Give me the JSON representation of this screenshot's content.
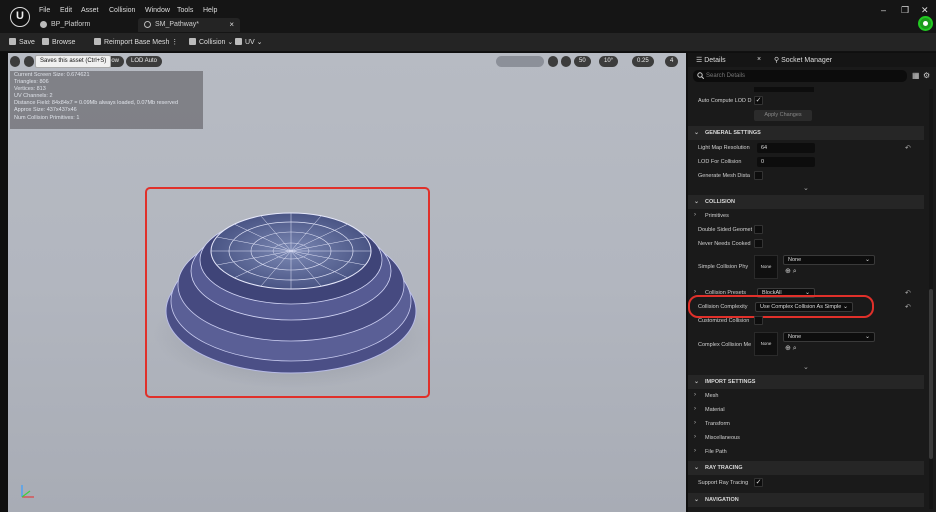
{
  "app": {
    "logo": "U",
    "menu": [
      "File",
      "Edit",
      "Asset",
      "Collision",
      "Window",
      "Tools",
      "Help"
    ],
    "tabs": [
      {
        "label": "BP_Platform",
        "icon": "blueprint-icon"
      },
      {
        "label": "SM_Pathway*",
        "icon": "static-mesh-icon"
      }
    ],
    "tab_close": "×",
    "window_controls": {
      "minimize": "–",
      "maximize": "❐",
      "close": "✕"
    }
  },
  "toolbar": {
    "save_label": "Save",
    "browse_label": "Browse",
    "reimport_label": "Reimport Base Mesh",
    "collision_label": "Collision",
    "uv_label": "UV",
    "tooltip": "Saves this asset (Ctrl+S)"
  },
  "viewport": {
    "show_label": "how",
    "lod_label": "LOD Auto",
    "right_controls": [
      "50",
      "10°",
      "0.25",
      "4"
    ],
    "stats": [
      "Current Screen Size: 0.674621",
      "Triangles: 806",
      "Vertices: 813",
      "UV Channels: 2",
      "Distance Field: 84x84x7 = 0.09Mb always loaded, 0.07Mb reserved",
      "Approx Size: 437x437x46",
      "Num Collision Primitives: 1"
    ]
  },
  "details": {
    "tab_details": "Details",
    "tab_socket_manager": "Socket Manager",
    "search_placeholder": "Search Details",
    "auto_compute_lod_label": "Auto Compute LOD D",
    "apply_changes_label": "Apply Changes",
    "general_settings": {
      "title": "GENERAL SETTINGS",
      "light_map_resolution_label": "Light Map Resolution",
      "light_map_resolution_value": "64",
      "lod_for_collision_label": "LOD For Collision",
      "lod_for_collision_value": "0",
      "generate_mesh_dist_label": "Generate Mesh Dista"
    },
    "collision": {
      "title": "COLLISION",
      "primitives_label": "Primitives",
      "double_sided_label": "Double Sided Geomet",
      "never_needs_cooked_label": "Never Needs Cooked",
      "simple_collision_phys_label": "Simple Collision Phy",
      "simple_collision_thumb": "None",
      "simple_collision_value": "None",
      "collision_presets_label": "Collision Presets",
      "collision_presets_value": "BlockAll",
      "collision_complexity_label": "Collision Complexity",
      "collision_complexity_value": "Use Complex Collision As Simple",
      "customized_collision_label": "Customized Collision",
      "complex_collision_mesh_label": "Complex Collision Me",
      "complex_collision_thumb": "None",
      "complex_collision_value": "None"
    },
    "import_settings": {
      "title": "IMPORT SETTINGS",
      "items": [
        "Mesh",
        "Material",
        "Transform",
        "Miscellaneous",
        "File Path"
      ]
    },
    "ray_tracing": {
      "title": "RAY TRACING",
      "support_ray_tracing_label": "Support Ray Tracing"
    },
    "navigation": {
      "title": "NAVIGATION"
    }
  },
  "colors": {
    "highlight_red": "#e0302a",
    "accent_green": "#1b9b1b"
  }
}
